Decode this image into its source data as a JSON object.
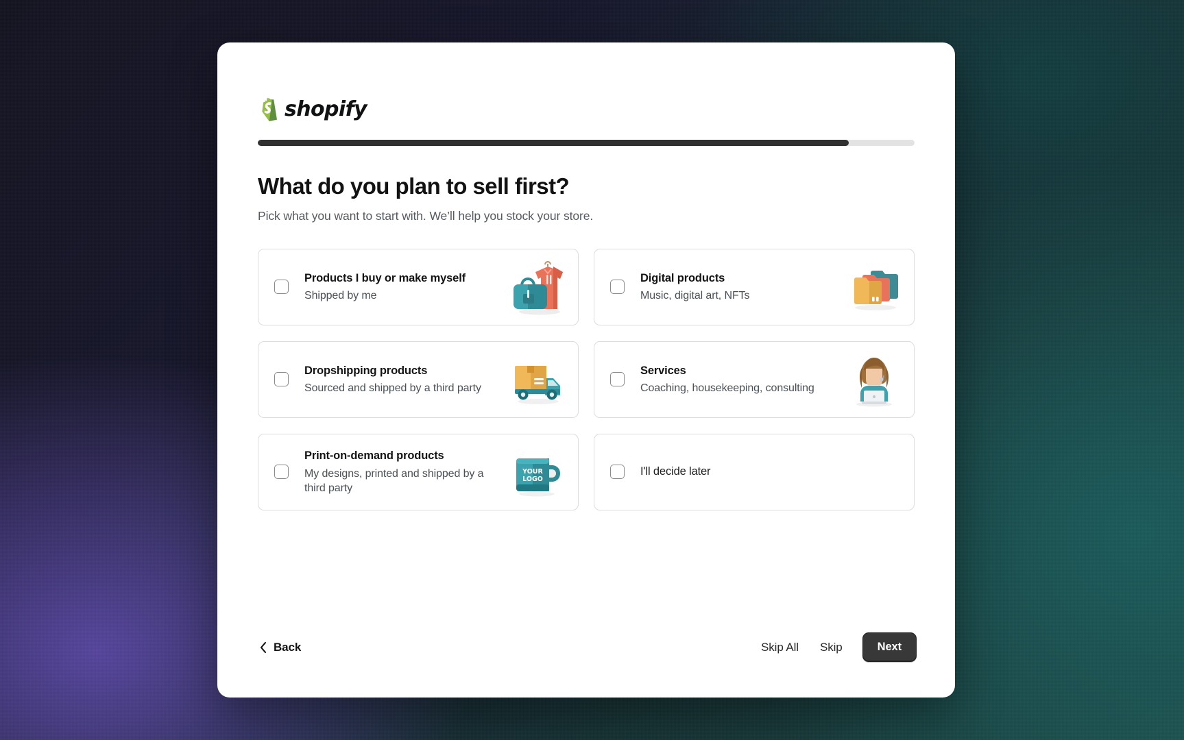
{
  "brand": {
    "name": "shopify",
    "logo_green": "#95BF47",
    "logo_green_dark": "#5E8E3E"
  },
  "progress": {
    "percent": 90,
    "fill_color": "#303030",
    "track_color": "#e3e3e3"
  },
  "heading": {
    "title": "What do you plan to sell first?",
    "subtitle": "Pick what you want to start with. We’ll help you stock your store."
  },
  "options": [
    {
      "id": "products-i-buy-or-make-myself",
      "title": "Products I buy or make myself",
      "desc": "Shipped by me",
      "icon": "bag-and-hoodie-icon",
      "checked": false
    },
    {
      "id": "digital-products",
      "title": "Digital products",
      "desc": "Music, digital art, NFTs",
      "icon": "folders-icon",
      "checked": false
    },
    {
      "id": "dropshipping-products",
      "title": "Dropshipping products",
      "desc": "Sourced and shipped by a third party",
      "icon": "delivery-truck-icon",
      "checked": false
    },
    {
      "id": "services",
      "title": "Services",
      "desc": "Coaching, housekeeping, consulting",
      "icon": "support-agent-icon",
      "checked": false
    },
    {
      "id": "print-on-demand-products",
      "title": "Print-on-demand products",
      "desc": "My designs, printed and shipped by a third party",
      "icon": "printed-mug-icon",
      "checked": false
    },
    {
      "id": "ill-decide-later",
      "title": "I'll decide later",
      "desc": "",
      "icon": "",
      "checked": false
    }
  ],
  "mug_art": {
    "line1": "YOUR",
    "line2": "LOGO"
  },
  "footer": {
    "back_label": "Back",
    "skip_all_label": "Skip All",
    "skip_label": "Skip",
    "next_label": "Next"
  }
}
